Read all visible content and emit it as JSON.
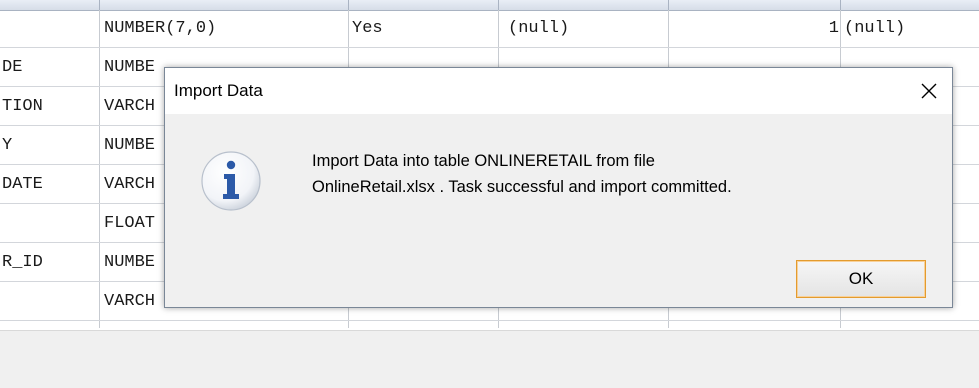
{
  "table": {
    "rows": [
      {
        "name": "",
        "type": "NUMBER(7,0)",
        "nullable": "Yes",
        "default": "(null)",
        "col_id": "1",
        "comments": "(null)"
      },
      {
        "name": "DE",
        "type": "NUMBE",
        "nullable": "",
        "default": "",
        "col_id": "",
        "comments": ""
      },
      {
        "name": "TION",
        "type": "VARCH",
        "nullable": "",
        "default": "",
        "col_id": "",
        "comments": ""
      },
      {
        "name": "Y",
        "type": "NUMBE",
        "nullable": "",
        "default": "",
        "col_id": "",
        "comments": ""
      },
      {
        "name": "DATE",
        "type": "VARCH",
        "nullable": "",
        "default": "",
        "col_id": "",
        "comments": ""
      },
      {
        "name": "",
        "type": "FLOAT",
        "nullable": "",
        "default": "",
        "col_id": "",
        "comments": ""
      },
      {
        "name": "R_ID",
        "type": "NUMBE",
        "nullable": "",
        "default": "",
        "col_id": "",
        "comments": ""
      },
      {
        "name": "",
        "type": "VARCH",
        "nullable": "",
        "default": "",
        "col_id": "",
        "comments": ""
      }
    ]
  },
  "dialog": {
    "title": "Import Data",
    "close_icon": "close-icon",
    "info_icon": "info-icon",
    "message_line1": "Import Data into table ONLINERETAIL from file",
    "message_line2": "OnlineRetail.xlsx . Task successful and import committed.",
    "ok_label": "OK",
    "ok_border_color": "#e39b2e"
  }
}
